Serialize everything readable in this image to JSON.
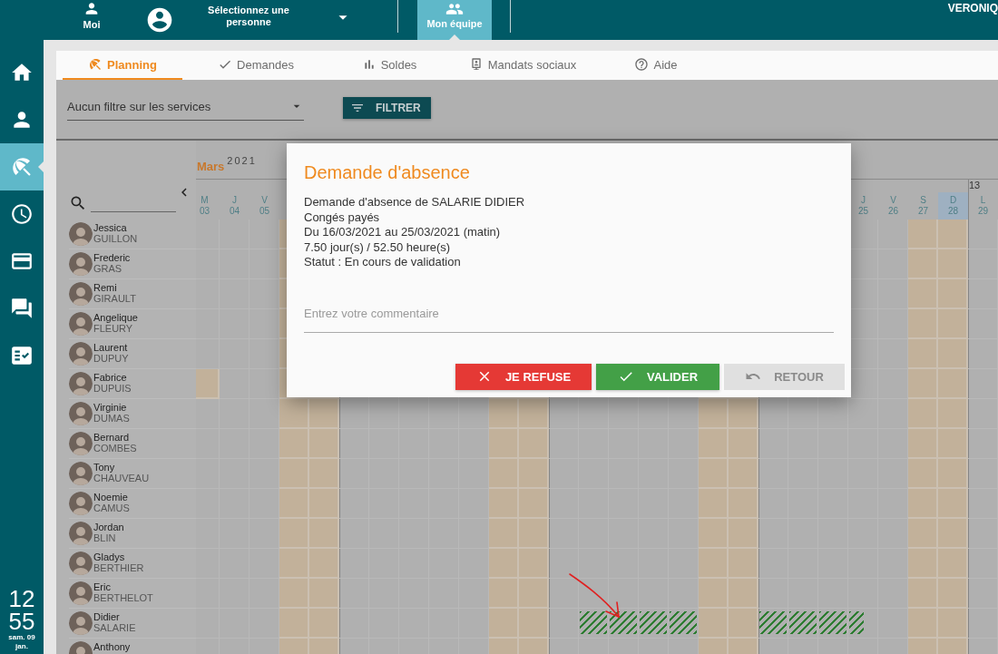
{
  "top_bar": {
    "me": {
      "label": "Moi"
    },
    "person_select": {
      "placeholder": "Sélectionnez une personne"
    },
    "team_tab": {
      "label": "Mon équipe",
      "selected": true
    },
    "user": "VERONIQ"
  },
  "sidebar": {
    "items": [
      {
        "selected": false
      },
      {
        "selected": false
      },
      {
        "selected": true
      },
      {
        "selected": false
      },
      {
        "selected": false
      },
      {
        "selected": false
      },
      {
        "selected": false
      }
    ],
    "clock": {
      "hours": "12",
      "minutes": "55",
      "date": "sam. 09",
      "month": "jan."
    }
  },
  "tabs": [
    {
      "label": "Planning",
      "selected": true
    },
    {
      "label": "Demandes",
      "selected": false
    },
    {
      "label": "Soldes",
      "selected": false
    },
    {
      "label": "Mandats sociaux",
      "selected": false
    },
    {
      "label": "Aide",
      "selected": false
    }
  ],
  "filter": {
    "value": "Aucun filtre sur les services",
    "button": "FILTRER"
  },
  "planner": {
    "month": "Mars",
    "year": "2021",
    "days": [
      {
        "letter": "M",
        "number": "03",
        "highlighted": false,
        "weekend": false
      },
      {
        "letter": "J",
        "number": "04",
        "highlighted": false,
        "weekend": false
      },
      {
        "letter": "V",
        "number": "05",
        "highlighted": false,
        "weekend": false
      },
      {
        "weekend": true
      },
      {
        "weekend": true
      },
      {
        "weekend": false
      },
      {
        "weekend": false
      },
      {
        "weekend": false
      },
      {
        "weekend": false
      },
      {
        "weekend": false
      },
      {
        "weekend": true
      },
      {
        "weekend": true
      },
      {
        "weekend": false
      },
      {
        "weekend": false
      },
      {
        "weekend": false
      },
      {
        "weekend": false
      },
      {
        "weekend": false
      },
      {
        "weekend": true
      },
      {
        "weekend": true
      },
      {
        "weekend": false
      },
      {
        "weekend": false
      },
      {
        "weekend": false
      },
      {
        "letter": "J",
        "number": "25",
        "highlighted": false,
        "weekend": false
      },
      {
        "letter": "V",
        "number": "26",
        "highlighted": false,
        "weekend": false
      },
      {
        "letter": "S",
        "number": "27",
        "highlighted": false,
        "weekend": true
      },
      {
        "letter": "D",
        "number": "28",
        "highlighted": true,
        "weekend": true
      },
      {
        "letter": "L",
        "number": "29",
        "highlighted": false,
        "weekend": false,
        "week": "13"
      }
    ],
    "people": [
      {
        "first": "Jessica",
        "last": "GUILLON"
      },
      {
        "first": "Frederic",
        "last": "GRAS"
      },
      {
        "first": "Remi",
        "last": "GIRAULT"
      },
      {
        "first": "Angelique",
        "last": "FLEURY"
      },
      {
        "first": "Laurent",
        "last": "DUPUY"
      },
      {
        "first": "Fabrice",
        "last": "DUPUIS",
        "cells": [
          {
            "kind": "off"
          },
          {
            "kind": "free"
          },
          {
            "kind": "free"
          },
          {
            "kind": "free"
          },
          {
            "kind": "free"
          },
          {
            "kind": "free"
          },
          {
            "kind": "free"
          },
          {
            "kind": "free"
          },
          {
            "kind": "free"
          },
          {
            "kind": "free"
          },
          {
            "kind": "free"
          },
          {
            "kind": "free"
          },
          {
            "kind": "free"
          },
          {
            "kind": "free"
          },
          {
            "kind": "free"
          },
          {
            "kind": "free"
          },
          {
            "kind": "free"
          },
          {
            "kind": "free"
          },
          {
            "kind": "free"
          },
          {
            "kind": "free"
          },
          {
            "kind": "free"
          },
          {
            "kind": "free"
          },
          {
            "kind": "free"
          },
          {
            "kind": "free"
          },
          {
            "kind": "free"
          },
          {
            "kind": "free"
          },
          {
            "kind": "free"
          }
        ]
      },
      {
        "first": "Virginie",
        "last": "DUMAS"
      },
      {
        "first": "Bernard",
        "last": "COMBES"
      },
      {
        "first": "Tony",
        "last": "CHAUVEAU"
      },
      {
        "first": "Noemie",
        "last": "CAMUS"
      },
      {
        "first": "Jordan",
        "last": "BLIN"
      },
      {
        "first": "Gladys",
        "last": "BERTHIER"
      },
      {
        "first": "Eric",
        "last": "BERTHELOT"
      },
      {
        "first": "Didier",
        "last": "SALARIE",
        "cells": [
          {
            "kind": "free"
          },
          {
            "kind": "free"
          },
          {
            "kind": "free"
          },
          {
            "kind": "free"
          },
          {
            "kind": "free"
          },
          {
            "kind": "free"
          },
          {
            "kind": "free"
          },
          {
            "kind": "free"
          },
          {
            "kind": "free"
          },
          {
            "kind": "free"
          },
          {
            "kind": "free"
          },
          {
            "kind": "free"
          },
          {
            "kind": "free"
          },
          {
            "kind": "pending"
          },
          {
            "kind": "pending"
          },
          {
            "kind": "pending"
          },
          {
            "kind": "pending"
          },
          {
            "kind": "free"
          },
          {
            "kind": "free"
          },
          {
            "kind": "pending"
          },
          {
            "kind": "pending"
          },
          {
            "kind": "pending"
          },
          {
            "kind": "pending_am"
          },
          {
            "kind": "free"
          },
          {
            "kind": "free"
          },
          {
            "kind": "free"
          },
          {
            "kind": "free"
          }
        ]
      },
      {
        "first": "Anthony"
      }
    ]
  },
  "dialog": {
    "title": "Demande d'absence",
    "lines": [
      "Demande d'absence de SALARIE DIDIER",
      "Congés payés",
      "Du 16/03/2021 au 25/03/2021 (matin)",
      "7.50 jour(s) / 52.50 heure(s)",
      "Statut : En cours de validation"
    ],
    "comment": {
      "placeholder": "Entrez votre commentaire"
    },
    "buttons": [
      {
        "label": "JE REFUSE",
        "kind": "refuse",
        "disabled": false
      },
      {
        "label": "VALIDER",
        "kind": "validate",
        "disabled": false
      },
      {
        "label": "RETOUR",
        "kind": "back",
        "disabled": true
      }
    ]
  }
}
